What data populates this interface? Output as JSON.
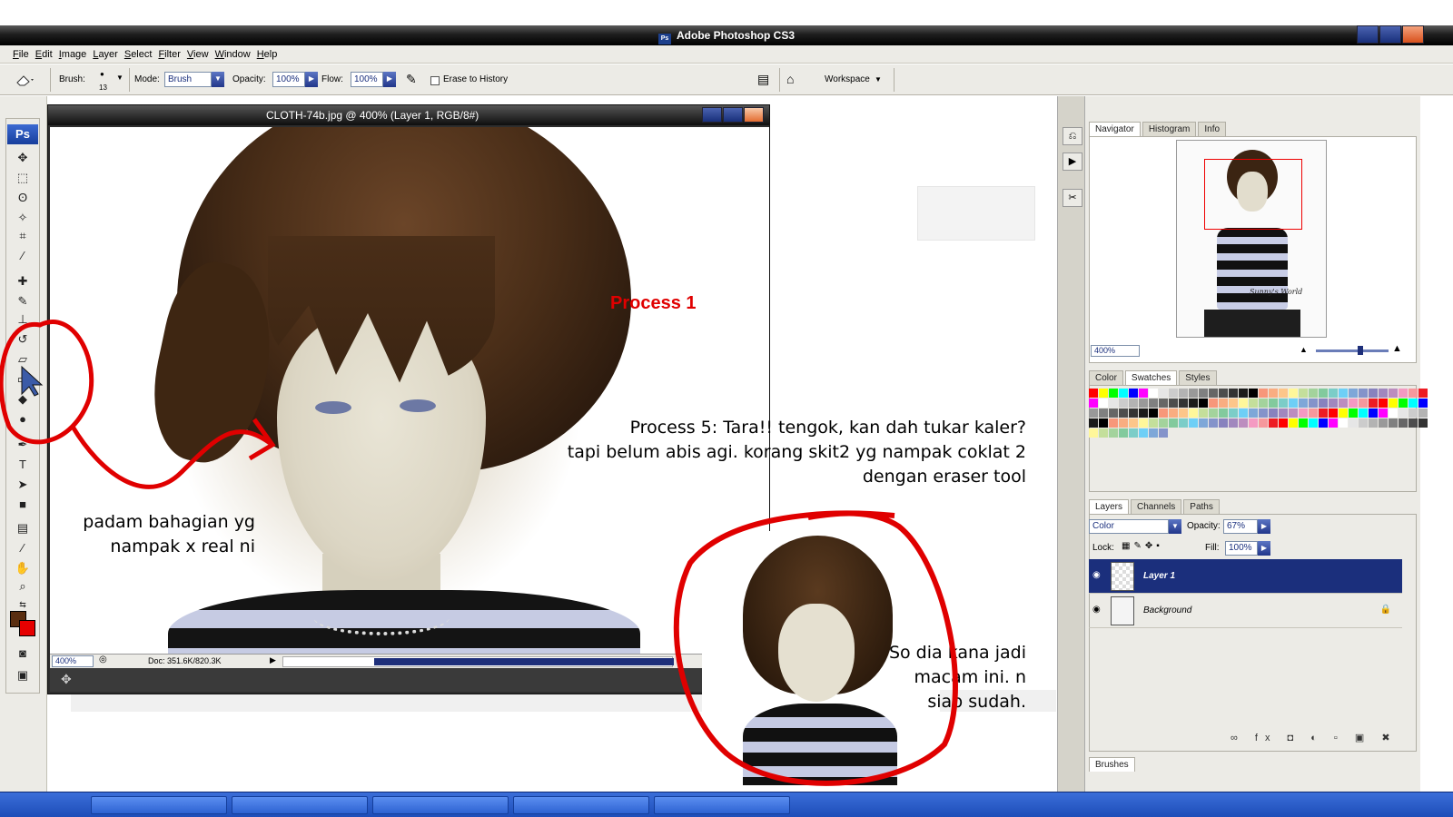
{
  "app": {
    "title": "Adobe Photoshop CS3",
    "logo": "Ps"
  },
  "menu": [
    "File",
    "Edit",
    "Image",
    "Layer",
    "Select",
    "Filter",
    "View",
    "Window",
    "Help"
  ],
  "options": {
    "brush_label": "Brush:",
    "brush_size": "13",
    "mode_label": "Mode:",
    "mode_value": "Brush",
    "opacity_label": "Opacity:",
    "opacity_value": "100%",
    "flow_label": "Flow:",
    "flow_value": "100%",
    "erase_history": "Erase to History",
    "workspace": "Workspace"
  },
  "document": {
    "title": "CLOTH-74b.jpg @ 400% (Layer 1, RGB/8#)",
    "zoom": "400%",
    "doc_size": "Doc: 351.6K/820.3K"
  },
  "navigator": {
    "tabs": [
      "Navigator",
      "Histogram",
      "Info"
    ],
    "zoom": "400%",
    "signature": "Sunny's World"
  },
  "swatches_panel": {
    "tabs": [
      "Color",
      "Swatches",
      "Styles"
    ],
    "colors": [
      "#ff0000",
      "#ffff00",
      "#00ff00",
      "#00ffff",
      "#0000ff",
      "#ff00ff",
      "#ffffff",
      "#e6e6e6",
      "#cccccc",
      "#b3b3b3",
      "#999999",
      "#808080",
      "#666666",
      "#4d4d4d",
      "#333333",
      "#1a1a1a",
      "#000000",
      "#f7977a",
      "#f9ad81",
      "#fdc68a",
      "#fff79a",
      "#c4df9b",
      "#a3d39c",
      "#82ca9d",
      "#7bcdc8",
      "#6ecff6",
      "#7ea7d8",
      "#8493ca",
      "#8882be",
      "#a187be",
      "#bc8dbf",
      "#f49ac2",
      "#f6989d",
      "#ed1c24"
    ]
  },
  "layers_panel": {
    "tabs": [
      "Layers",
      "Channels",
      "Paths"
    ],
    "blend_mode": "Color",
    "opacity_label": "Opacity:",
    "opacity": "67%",
    "lock_label": "Lock:",
    "fill_label": "Fill:",
    "fill": "100%",
    "layers": [
      {
        "name": "Layer 1",
        "selected": true
      },
      {
        "name": "Background",
        "selected": false
      }
    ]
  },
  "brushes_tab": "Brushes",
  "annotations": {
    "process1": "Process 1",
    "process5_line1": "Process 5: Tara!! tengok, kan dah tukar kaler?",
    "process5_line2": "tapi belum abis agi. korang skit2 yg nampak coklat 2",
    "process5_line3": "dengan eraser tool",
    "left_line1": "padam bahagian yg",
    "left_line2": "nampak x real ni",
    "right_line1": "So dia kana jadi",
    "right_line2": "macam ini. n",
    "right_line3": "siap sudah."
  },
  "colors": {
    "foreground": "#5a2e10",
    "background": "#e60000",
    "highlight": "#1b2f7c",
    "annotation_red": "#e00000"
  }
}
